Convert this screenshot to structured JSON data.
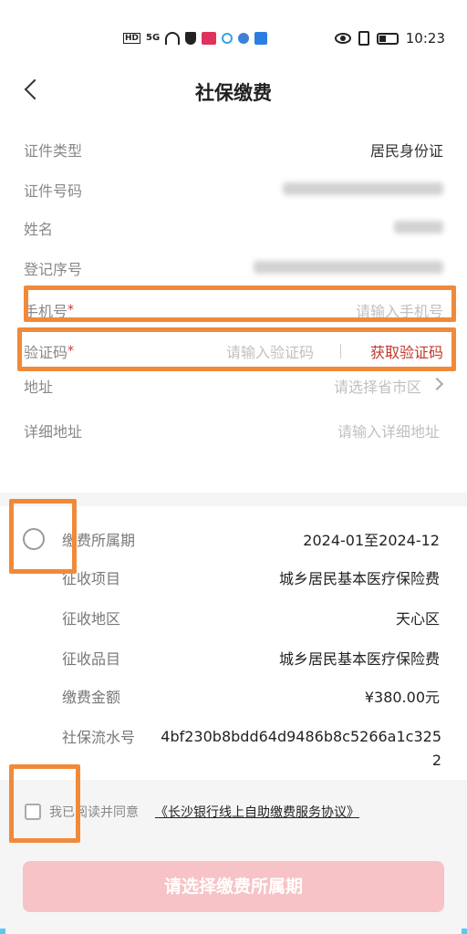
{
  "status_bar": {
    "network_badge": "HD",
    "signal": "5G",
    "time": "10:23"
  },
  "nav": {
    "title": "社保缴费"
  },
  "form": {
    "id_type": {
      "label": "证件类型",
      "value": "居民身份证"
    },
    "id_number": {
      "label": "证件号码"
    },
    "name": {
      "label": "姓名"
    },
    "reg_number": {
      "label": "登记序号"
    },
    "phone": {
      "label": "手机号",
      "required": "*",
      "placeholder": "请输入手机号"
    },
    "code": {
      "label": "验证码",
      "required": "*",
      "placeholder": "请输入验证码",
      "get_code": "获取验证码"
    },
    "address": {
      "label": "地址",
      "placeholder": "请选择省市区"
    },
    "detail_address": {
      "label": "详细地址",
      "placeholder": "请输入详细地址"
    }
  },
  "payment": {
    "period": {
      "label": "缴费所属期",
      "value": "2024-01至2024-12"
    },
    "item": {
      "label": "征收项目",
      "value": "城乡居民基本医疗保险费"
    },
    "area": {
      "label": "征收地区",
      "value": "天心区"
    },
    "category": {
      "label": "征收品目",
      "value": "城乡居民基本医疗保险费"
    },
    "amount": {
      "label": "缴费金额",
      "value": "¥380.00元"
    },
    "serial": {
      "label": "社保流水号",
      "value": "4bf230b8bdd64d9486b8c5266a1c3252"
    }
  },
  "agreement": {
    "text": "我已阅读并同意",
    "link": "《长沙银行线上自助缴费服务协议》"
  },
  "submit_label": "请选择缴费所属期",
  "colors": {
    "highlight": "#f08a3a",
    "accent_red": "#c0392b",
    "submit_bg": "#f7c3c6"
  }
}
